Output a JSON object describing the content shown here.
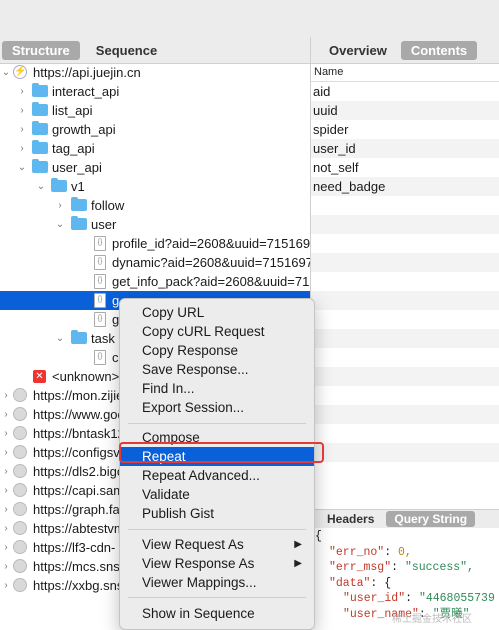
{
  "left_tabs": [
    "Structure",
    "Sequence"
  ],
  "right_tabs": [
    "Overview",
    "Contents"
  ],
  "name_header": "Name",
  "params": [
    "aid",
    "uuid",
    "spider",
    "user_id",
    "not_self",
    "need_badge"
  ],
  "tree": [
    "https://api.juejin.cn",
    "interact_api",
    "list_api",
    "growth_api",
    "tag_api",
    "user_api",
    "v1",
    "follow",
    "user",
    "profile_id?aid=2608&uuid=715169",
    "dynamic?aid=2608&uuid=7151697",
    "get_info_pack?aid=2608&uuid=71",
    "g",
    "g",
    "task",
    "c",
    "<unknown>",
    "https://mon.zijie",
    "https://www.goo",
    "https://bntask12",
    "https://configsv",
    "https://dls2.bigo",
    "https://capi.sam",
    "https://graph.fa",
    "https://abtestvm",
    "https://lf3-cdn-",
    "https://mcs.snss",
    "https://xxbg.sns"
  ],
  "menu": [
    "Copy URL",
    "Copy cURL Request",
    "Copy Response",
    "Save Response...",
    "Find In...",
    "Export Session...",
    "Compose",
    "Repeat",
    "Repeat Advanced...",
    "Validate",
    "Publish Gist",
    "View Request As",
    "View Response As",
    "Viewer Mappings...",
    "Show in Sequence"
  ],
  "bottom_tabs": [
    "Headers",
    "Query String"
  ],
  "json": {
    "open": "{",
    "k1": "\"err_no\"",
    "v1": "0,",
    "k2": "\"err_msg\"",
    "v2": "\"success\",",
    "k3": "\"data\"",
    "v3": "{",
    "k4": "\"user_id\"",
    "v4": "\"4468055739",
    "k5": "\"user_name\"",
    "v5": "\"贾曦\""
  },
  "watermark": "稀土掘金技术社区",
  "colors": {
    "selection": "#0a60d8",
    "annotation": "#e23a3a"
  }
}
